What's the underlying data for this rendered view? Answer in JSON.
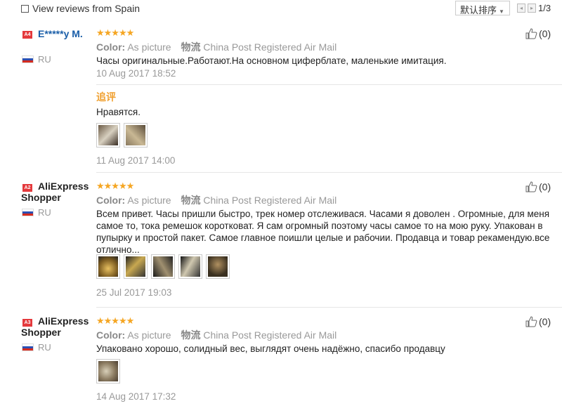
{
  "filter": {
    "label": "View reviews from Spain"
  },
  "sort": {
    "label": "默认排序"
  },
  "pagination": {
    "prev": "◂",
    "next": "▸",
    "text": "1/3"
  },
  "reviews": [
    {
      "badge": "A4",
      "user": "E*****y M.",
      "country": "RU",
      "stars": "★★★★★",
      "color_label": "Color:",
      "color_value": "As picture",
      "shipping_label": "物流",
      "shipping_value": "China Post Registered Air Mail",
      "likes": "(0)",
      "text": "Часы оригинальные.Работают.На основном циферблате, маленькие имитация.",
      "date": "10 Aug 2017 18:52",
      "followup_label": "追评",
      "followup_text": "Нравятся.",
      "followup_date": "11 Aug 2017 14:00"
    },
    {
      "badge": "A2",
      "user": "AliExpress Shopper",
      "country": "RU",
      "stars": "★★★★★",
      "color_label": "Color:",
      "color_value": "As picture",
      "shipping_label": "物流",
      "shipping_value": "China Post Registered Air Mail",
      "likes": "(0)",
      "text": "Всем привет. Часы пришли быстро, трек номер отслеживася. Часами я доволен . Огромные, для меня самое то, тока ремешок коротковат. Я сам огромный поэтому часы самое то на мою руку. Упакован в пупырку и простой пакет. Самое главное поишли целые и рабочии. Продавца и товар рекамендую.все отлично...",
      "date": "25 Jul 2017 19:03"
    },
    {
      "badge": "A3",
      "user": "AliExpress Shopper",
      "country": "RU",
      "stars": "★★★★★",
      "color_label": "Color:",
      "color_value": "As picture",
      "shipping_label": "物流",
      "shipping_value": "China Post Registered Air Mail",
      "likes": "(0)",
      "text": "Упаковано хорошо, солидный вес, выглядят очень надёжно, спасибо продавцу",
      "date": "14 Aug 2017 17:32"
    }
  ]
}
